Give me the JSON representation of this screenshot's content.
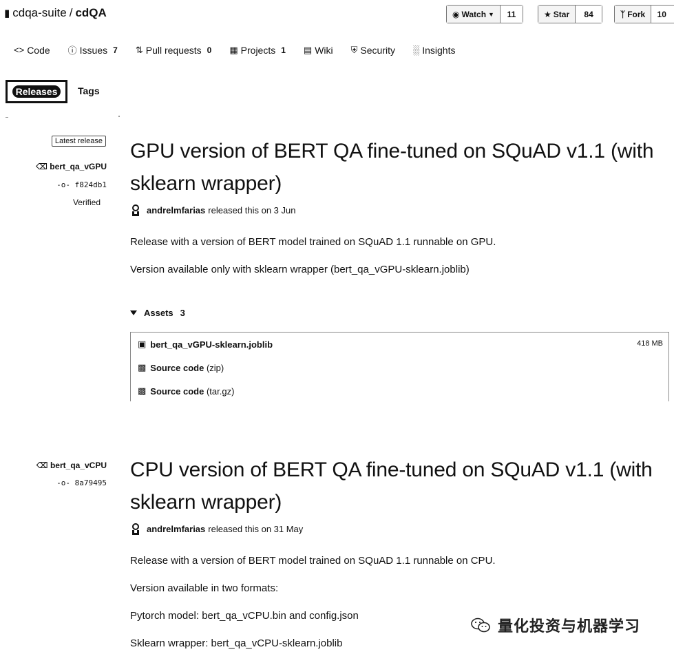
{
  "header": {
    "owner": "cdqa-suite",
    "separator": "/",
    "repo": "cdQA",
    "watch": {
      "label": "Watch",
      "count": "11"
    },
    "star": {
      "label": "Star",
      "count": "84"
    },
    "fork": {
      "label": "Fork",
      "count": "10"
    }
  },
  "tabs": [
    {
      "label": "Code",
      "count": ""
    },
    {
      "label": "Issues",
      "count": "7"
    },
    {
      "label": "Pull requests",
      "count": "0"
    },
    {
      "label": "Projects",
      "count": "1"
    },
    {
      "label": "Wiki",
      "count": ""
    },
    {
      "label": "Security",
      "count": ""
    },
    {
      "label": "Insights",
      "count": ""
    }
  ],
  "subnav": {
    "releases": "Releases",
    "tags": "Tags"
  },
  "releases": [
    {
      "badge": "Latest release",
      "tag": "bert_qa_vGPU",
      "commit": "f824db1",
      "verified": "Verified",
      "title": "GPU version of BERT QA fine-tuned on SQuAD v1.1 (with sklearn wrapper)",
      "author": "andrelmfarias",
      "released_text": "released this on 3 Jun",
      "paragraphs": [
        "Release with a version of BERT model trained on SQuAD 1.1 runnable on GPU.",
        "Version available only with sklearn wrapper (bert_qa_vGPU-sklearn.joblib)"
      ],
      "assets_label": "Assets",
      "assets_count": "3",
      "assets": [
        {
          "name": "bert_qa_vGPU-sklearn.joblib",
          "size": "418 MB"
        },
        {
          "name": "Source code",
          "suffix": "(zip)"
        },
        {
          "name": "Source code",
          "suffix": "(tar.gz)"
        }
      ]
    },
    {
      "tag": "bert_qa_vCPU",
      "commit": "8a79495",
      "title": "CPU version of BERT QA fine-tuned on SQuAD v1.1 (with sklearn wrapper)",
      "author": "andrelmfarias",
      "released_text": "released this on 31 May",
      "paragraphs": [
        "Release with a version of BERT model trained on SQuAD 1.1 runnable on CPU.",
        "Version available in two formats:",
        "Pytorch model: bert_qa_vCPU.bin and config.json",
        "Sklearn wrapper: bert_qa_vCPU-sklearn.joblib"
      ]
    }
  ],
  "watermark": "量化投资与机器学习"
}
